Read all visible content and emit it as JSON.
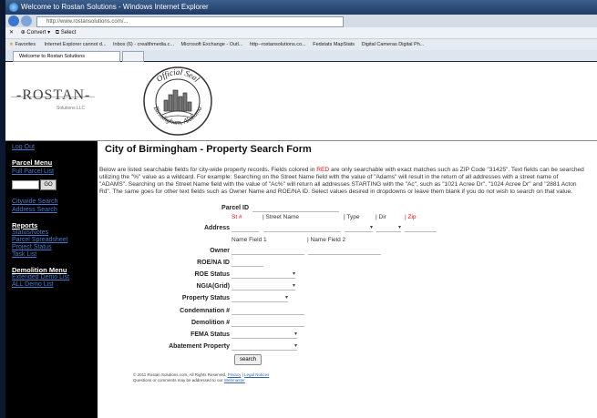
{
  "browser": {
    "window_title": "Welcome to Rostan Solutions - Windows Internet Explorer",
    "url": "http://www.rostansolutions.com/...",
    "command_bar": {
      "convert": "Convert",
      "select": "Select"
    },
    "favorites": {
      "label": "Favorites",
      "items": [
        "Internet Explorer cannot d...",
        "Inbox (6) - crealthmedia.c...",
        "Microsoft Exchange - Outl...",
        "http--rostansolutions.co...",
        "Fedstats MapStats",
        "Digital Cameras Digital Ph..."
      ]
    },
    "tab_title": "Welcome to Rostan Solutions"
  },
  "header": {
    "logo_text": "-ROSTAN-",
    "logo_sub": "Solutions LLC",
    "seal_top": "Official Seal",
    "seal_bottom": "Birmingham, Alabama"
  },
  "sidebar": {
    "logout": "Log Out",
    "parcel_menu": "Parcel Menu",
    "full_parcel_list": "Full Parcel List",
    "go": "GO",
    "citywide_search": "Citywide Search",
    "address_search": "Address Search",
    "reports": "Reports",
    "status_notes": "Status/Notes",
    "parcel_spreadsheet": "Parcel Spreadsheet",
    "project_status": "Project Status",
    "task_list": "Task List",
    "demolition_menu": "Demolition Menu",
    "extended_demo_list": "Extended Demo List",
    "all_demo_list": "ALL Demo List"
  },
  "form": {
    "title": "City of Birmingham - Property Search Form",
    "intro_1": "Below are listed searchable fields for city-wide property records. Fields colored in ",
    "intro_red": "RED",
    "intro_2": " are only searchable with exact matches such as ZIP Code \"31425\". Text fields can be searched utilizing the \"%\" value as a wildcard. For example: Searching on the Street Name field with the value of \"Adams\" will result in the return of all addresses with a street name of \"ADAMS\". Searching on the Street Name field with the value of \"Ac%\" will return all addresses STARTING with the \"Ac\", such as \"1021 Acree Dr\", \"1024 Acree Dr\" and \"2881 Acton Rd\". The same goes for other text fields such as Owner Name and ROE/NA ID. Select values desired in dropdowns or leave them blank if you do not wish to search on that value.",
    "labels": {
      "parcel_id": "Parcel ID",
      "address": "Address",
      "owner": "Owner",
      "roe_na_id": "ROE/NA ID",
      "roe_status": "ROE Status",
      "ngia": "NGIA(Grid)",
      "property_status": "Property Status",
      "condemnation": "Condemnation #",
      "demolition": "Demolition #",
      "fema_status": "FEMA Status",
      "abatement": "Abatement Property"
    },
    "address_cols": {
      "st_no": "St #",
      "street_name": "| Street Name",
      "type": "| Type",
      "dir": "| Dir",
      "zip": "| Zip"
    },
    "name_fields": {
      "field1": "Name Field 1",
      "field2": "| Name Field 2"
    },
    "search_button": "search"
  },
  "footer": {
    "line1": "© 2011 Rostan Solutions.com, All Rights Reserved.",
    "privacy": "Privacy",
    "legal": "Legal Notices",
    "line2": "Questions or comments may be addressed to our",
    "webmaster": "Webmaster"
  },
  "colors": {
    "red_field": "#e01010",
    "link": "#4b78c9",
    "sidebar_bg": "#000000"
  }
}
